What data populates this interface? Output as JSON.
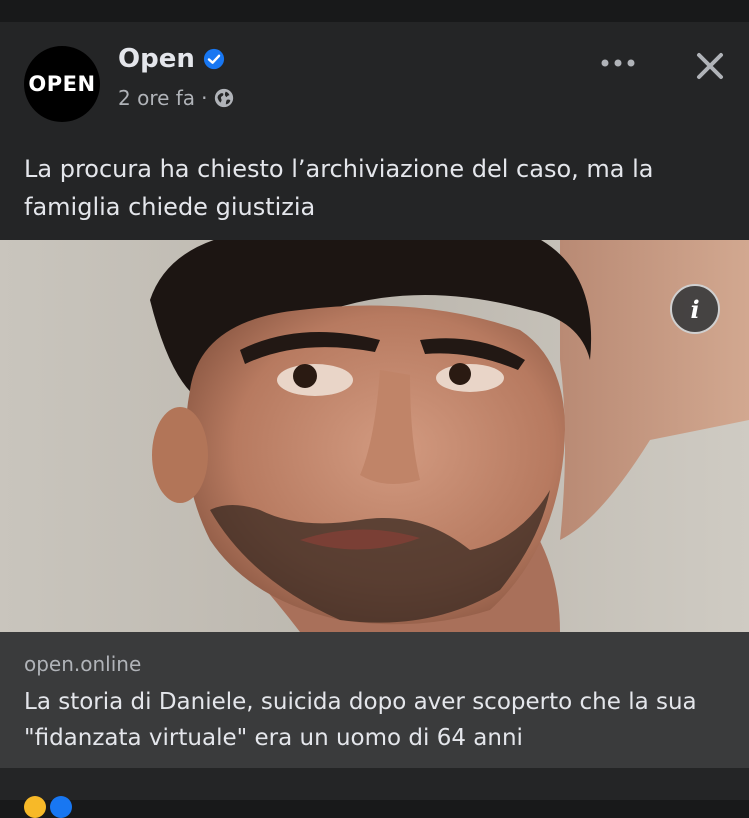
{
  "post": {
    "page_name": "Open",
    "avatar_text": "OPEN",
    "time": "2 ore fa",
    "separator": "·",
    "privacy_icon": "globe-icon",
    "verified_icon": "verified-badge-icon",
    "text": "La procura ha chiesto l’archiviazione del caso, ma la famiglia chiede giustizia",
    "more_icon": "more-icon",
    "close_icon": "close-icon"
  },
  "media": {
    "info_label": "i"
  },
  "link": {
    "domain": "open.online",
    "title": "La storia di Daniele, suicida dopo aver scoperto che la sua \"fidanzata virtuale\" era un uomo di 64 anni"
  },
  "colors": {
    "card_bg": "#242526",
    "link_bg": "#3a3b3c",
    "text_primary": "#e4e6eb",
    "text_secondary": "#b0b3b8",
    "verified_blue": "#1877f2"
  }
}
